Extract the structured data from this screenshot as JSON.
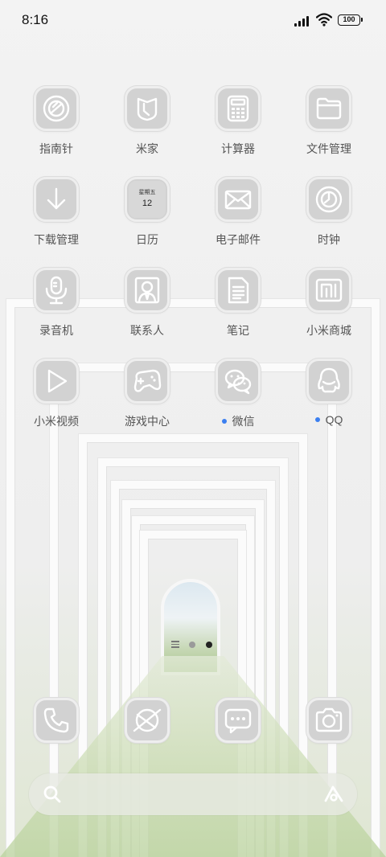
{
  "status_bar": {
    "time": "8:16",
    "battery": "100"
  },
  "apps": [
    {
      "label": "指南针",
      "icon": "compass-icon",
      "notify": false
    },
    {
      "label": "米家",
      "icon": "mijia-icon",
      "notify": false
    },
    {
      "label": "计算器",
      "icon": "calculator-icon",
      "notify": false
    },
    {
      "label": "文件管理",
      "icon": "folder-icon",
      "notify": false
    },
    {
      "label": "下载管理",
      "icon": "download-icon",
      "notify": false
    },
    {
      "label": "日历",
      "icon": "calendar-icon",
      "notify": false,
      "weekday": "星期五",
      "day": "12"
    },
    {
      "label": "电子邮件",
      "icon": "mail-icon",
      "notify": false
    },
    {
      "label": "时钟",
      "icon": "clock-icon",
      "notify": false
    },
    {
      "label": "录音机",
      "icon": "microphone-icon",
      "notify": false
    },
    {
      "label": "联系人",
      "icon": "contacts-icon",
      "notify": false
    },
    {
      "label": "笔记",
      "icon": "notes-icon",
      "notify": false
    },
    {
      "label": "小米商城",
      "icon": "mi-store-icon",
      "notify": false
    },
    {
      "label": "小米视频",
      "icon": "video-play-icon",
      "notify": false
    },
    {
      "label": "游戏中心",
      "icon": "gamepad-icon",
      "notify": false
    },
    {
      "label": "微信",
      "icon": "wechat-icon",
      "notify": true
    },
    {
      "label": "QQ",
      "icon": "qq-penguin-icon",
      "notify": true
    }
  ],
  "pager": {
    "pages": 2,
    "current": 2
  },
  "dock": [
    {
      "icon": "phone-icon"
    },
    {
      "icon": "browser-icon"
    },
    {
      "icon": "messages-icon"
    },
    {
      "icon": "camera-icon"
    }
  ],
  "colors": {
    "notify_dot": "#3b7ff0",
    "icon_fill": "#d2d2d2",
    "icon_stroke": "#ffffff"
  }
}
